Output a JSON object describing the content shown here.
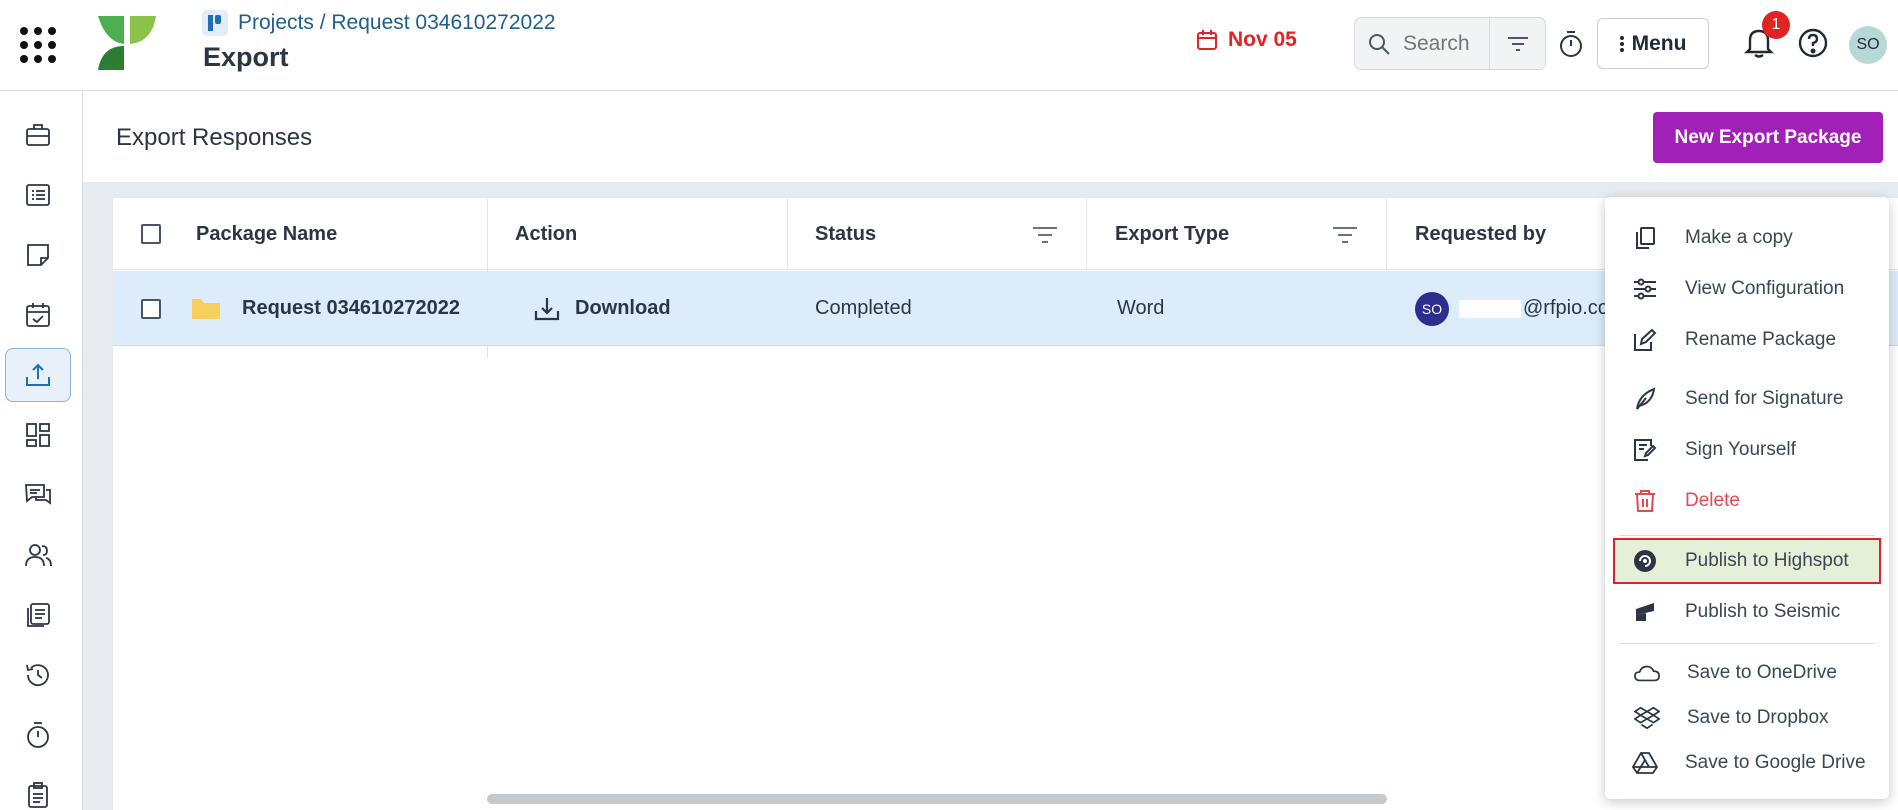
{
  "header": {
    "breadcrumb": "Projects / Request 034610272022",
    "title": "Export",
    "due_date": "Nov 05",
    "search_placeholder": "Search",
    "menu_label": "Menu",
    "notification_count": "1",
    "user_initials": "SO"
  },
  "sidebar": {
    "items": [
      {
        "icon": "briefcase-icon"
      },
      {
        "icon": "list-icon"
      },
      {
        "icon": "note-icon"
      },
      {
        "icon": "calendar-check-icon"
      },
      {
        "icon": "export-icon",
        "active": true
      },
      {
        "icon": "dashboard-icon"
      },
      {
        "icon": "chat-icon"
      },
      {
        "icon": "users-icon"
      },
      {
        "icon": "documents-icon"
      },
      {
        "icon": "history-icon"
      },
      {
        "icon": "timer-icon"
      },
      {
        "icon": "clipboard-icon"
      }
    ]
  },
  "main": {
    "section_title": "Export Responses",
    "new_package_label": "New Export Package",
    "table": {
      "columns": [
        "Package Name",
        "Action",
        "Status",
        "Export Type",
        "Requested by"
      ],
      "rows": [
        {
          "package_name": "Request 034610272022",
          "action": "Download",
          "status": "Completed",
          "export_type": "Word",
          "requester_initials": "SO",
          "requester_email": "@rfpio.co"
        }
      ]
    }
  },
  "context_menu": {
    "items": [
      {
        "label": "Make a copy",
        "icon": "copy-icon"
      },
      {
        "label": "View Configuration",
        "icon": "sliders-icon"
      },
      {
        "label": "Rename Package",
        "icon": "rename-icon"
      },
      {
        "label": "Send for Signature",
        "icon": "feather-pen-icon"
      },
      {
        "label": "Sign Yourself",
        "icon": "sign-edit-icon"
      },
      {
        "label": "Delete",
        "icon": "trash-icon"
      },
      {
        "label": "Publish to Highspot",
        "icon": "highspot-icon"
      },
      {
        "label": "Publish to Seismic",
        "icon": "seismic-icon"
      },
      {
        "label": "Save to OneDrive",
        "icon": "onedrive-icon"
      },
      {
        "label": "Save to Dropbox",
        "icon": "dropbox-icon"
      },
      {
        "label": "Save to Google Drive",
        "icon": "google-drive-icon"
      }
    ]
  },
  "colors": {
    "accent": "#a020b8",
    "danger": "#e02424",
    "row_selected": "#dcecfb",
    "link": "#1f5e8a"
  }
}
